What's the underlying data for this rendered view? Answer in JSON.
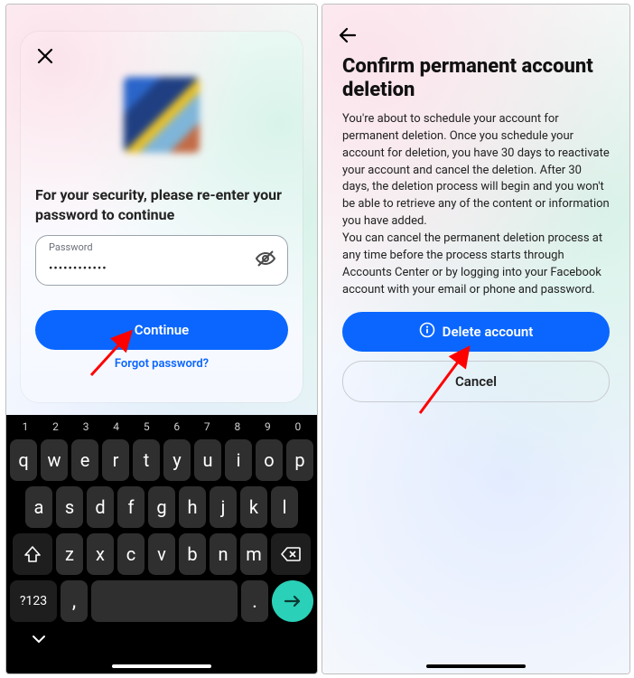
{
  "left": {
    "prompt": "For your security, please re-enter your password to continue",
    "password_label": "Password",
    "password_value": "••••••••••••",
    "continue_label": "Continue",
    "forgot_label": "Forgot password?"
  },
  "right": {
    "title": "Confirm permanent account deletion",
    "para1": "You're about to schedule your account for permanent deletion. Once you schedule your account for deletion, you have 30 days to reactivate your account and cancel the deletion. After 30 days, the deletion process will begin and you won't be able to retrieve any of the content or information you have added.",
    "para2": "You can cancel the permanent deletion process at any time before the process starts through Accounts Center or by logging into your Facebook account with your email or phone and password.",
    "delete_label": "Delete account",
    "cancel_label": "Cancel"
  },
  "keyboard": {
    "numbers": [
      "1",
      "2",
      "3",
      "4",
      "5",
      "6",
      "7",
      "8",
      "9",
      "0"
    ],
    "row1": [
      "q",
      "w",
      "e",
      "r",
      "t",
      "y",
      "u",
      "i",
      "o",
      "p"
    ],
    "row2": [
      "a",
      "s",
      "d",
      "f",
      "g",
      "h",
      "j",
      "k",
      "l"
    ],
    "row3": [
      "z",
      "x",
      "c",
      "v",
      "b",
      "n",
      "m"
    ],
    "symbols_label": "?123",
    "comma": ",",
    "period": "."
  }
}
